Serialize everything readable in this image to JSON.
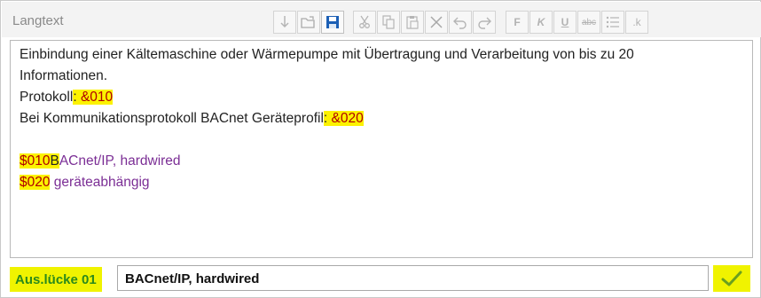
{
  "panel": {
    "title": "Langtext"
  },
  "toolbar": {
    "buttons": [
      {
        "name": "download-icon"
      },
      {
        "name": "open-folder-icon"
      },
      {
        "name": "save-icon"
      },
      {
        "name": "cut-icon"
      },
      {
        "name": "copy-icon"
      },
      {
        "name": "paste-icon"
      },
      {
        "name": "delete-icon"
      },
      {
        "name": "undo-icon"
      },
      {
        "name": "redo-icon"
      },
      {
        "name": "bold-button",
        "label": "F"
      },
      {
        "name": "italic-button",
        "label": "K"
      },
      {
        "name": "underline-button",
        "label": "U"
      },
      {
        "name": "strikethrough-button",
        "label": "abc"
      },
      {
        "name": "list-icon"
      },
      {
        "name": "format-button",
        "label": ".k"
      }
    ]
  },
  "editor": {
    "line1": "Einbindung einer Kältemaschine oder Wärmepumpe mit Übertragung und Verarbeitung von bis zu 20",
    "line2": "Informationen.",
    "line3_prefix": " Protokoll",
    "line3_placeholder": "&010",
    "line4_prefix": " Bei Kommunikationsprotokoll BACnet Geräteprofil",
    "line4_placeholder": "&020",
    "opt1_code": "$010",
    "opt1_text_first": "B",
    "opt1_text_rest": "ACnet/IP, hardwired",
    "opt2_code": "$020",
    "opt2_text": "geräteabhängig"
  },
  "footer": {
    "label": "Aus.lücke 01",
    "answer_value": "BACnet/IP, hardwired",
    "confirm_icon": "checkmark-icon"
  },
  "colors": {
    "highlight": "#fcf200",
    "option_text": "#7b2e95",
    "placeholder_text": "#b00000",
    "label_text": "#2b8a1b"
  }
}
